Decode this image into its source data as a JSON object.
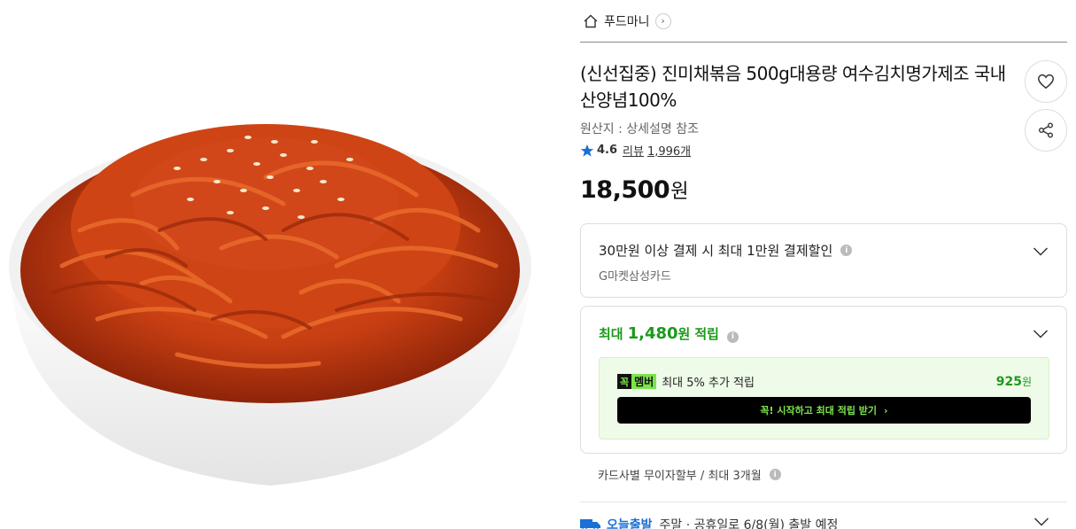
{
  "shop": {
    "name": "푸드마니",
    "arrow": "›"
  },
  "product": {
    "title": "(신선집중) 진미채볶음 500g대용량 여수김치명가제조 국내산양념100%",
    "origin": "원산지 : 상세설명 참조",
    "rating": "4.6",
    "review_label": "리뷰",
    "review_count": "1,996개",
    "price": "18,500",
    "price_unit": "원"
  },
  "discount": {
    "title": "30만원 이상 결제 시 최대 1만원 결제할인",
    "card": "G마켓삼성카드",
    "info_glyph": "i"
  },
  "reward": {
    "prefix": "최대",
    "amount": "1,480",
    "unit": "원",
    "suffix": "적립",
    "info_glyph": "i"
  },
  "member": {
    "logo_mark": "꼭",
    "logo_text": "멤버",
    "desc": "최대 5% 추가 적립",
    "amount": "925",
    "amount_unit": "원",
    "cta": "꼭! 시작하고 최대 적립 받기",
    "cta_arrow": "›"
  },
  "installment": {
    "text": "카드사별 무이자할부 / 최대 3개월",
    "info_glyph": "i"
  },
  "shipping": {
    "badge": "오늘출발",
    "text": "주말 · 공휴일로 6/8(월) 출발 예정"
  },
  "colors": {
    "accent_green": "#1a9a1a",
    "member_green": "#7ee34d",
    "star_blue": "#1a6fd8"
  },
  "icons": [
    "home-icon",
    "chevron-right-icon",
    "heart-icon",
    "share-icon",
    "star-icon",
    "chevron-down-icon",
    "info-icon",
    "truck-icon"
  ]
}
